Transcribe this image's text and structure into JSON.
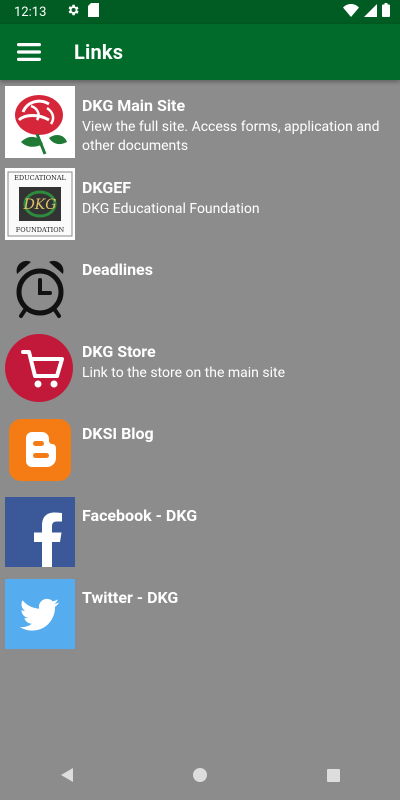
{
  "status_bar": {
    "time": "12:13"
  },
  "app_bar": {
    "title": "Links",
    "color": "#006b2b"
  },
  "links": [
    {
      "title": "DKG Main Site",
      "subtitle": "View the full site. Access forms, application and other documents",
      "icon": "rose-logo-icon"
    },
    {
      "title": "DKGEF",
      "subtitle": "DKG Educational Foundation",
      "icon": "dkg-educational-foundation-logo-icon",
      "logo_text": {
        "top": "EDUCATIONAL",
        "middle": "DKG",
        "bottom": "FOUNDATION"
      }
    },
    {
      "title": "Deadlines",
      "subtitle": "",
      "icon": "alarm-clock-icon"
    },
    {
      "title": "DKG Store",
      "subtitle": "Link to the store on the main site",
      "icon": "shopping-cart-icon"
    },
    {
      "title": "DKSI Blog",
      "subtitle": "",
      "icon": "blogger-icon"
    },
    {
      "title": "Facebook - DKG",
      "subtitle": "",
      "icon": "facebook-icon"
    },
    {
      "title": "Twitter - DKG",
      "subtitle": "",
      "icon": "twitter-icon"
    }
  ]
}
